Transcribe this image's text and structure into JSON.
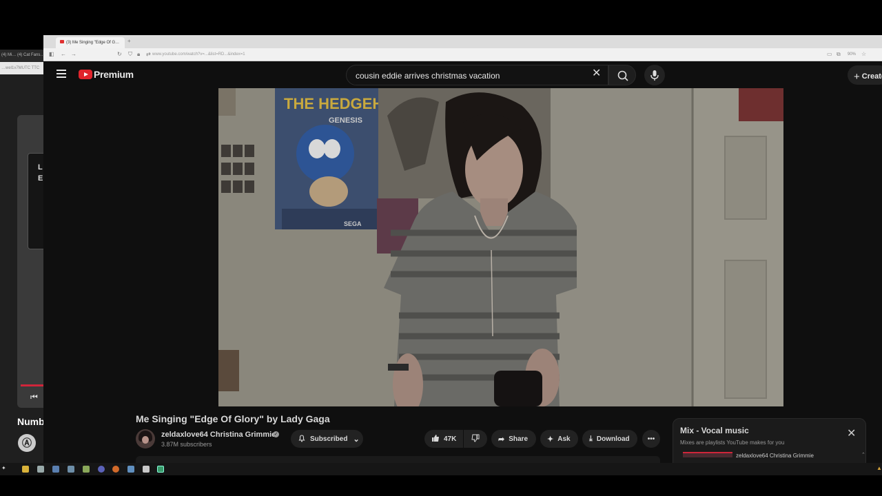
{
  "background_window": {
    "tab_text": "(4) Mi… (4) Cat Fans…",
    "url_text": "…wel1v7MUTC TTC",
    "card_text": "L\nE",
    "now_playing_title": "Numb"
  },
  "browser": {
    "tab_title": "(3) Me Singing \"Edge Of G…",
    "url": "www.youtube.com/watch?v=...&list=RD...&index=1",
    "zoom": "90%"
  },
  "youtube": {
    "logo_text": "Premium",
    "search": {
      "value": "cousin eddie arrives christmas vacation",
      "placeholder": "Search"
    },
    "create_label": "Create",
    "video": {
      "poster_title": "THE HEDGEHOG",
      "poster_subtitle": "GENESIS",
      "poster_brand": "SEGA"
    },
    "title": "Me Singing \"Edge Of Glory\" by Lady Gaga",
    "channel": {
      "name": "zeldaxlove64 Christina Grimmie",
      "subscribers": "3.87M subscribers"
    },
    "actions": {
      "subscribe": "Subscribed",
      "likes": "47K",
      "share": "Share",
      "ask": "Ask",
      "download": "Download"
    },
    "mix": {
      "title": "Mix - Vocal music",
      "subtitle": "Mixes are playlists YouTube makes for you",
      "first_item": "zeldaxlove64 Christina Grimmie"
    }
  },
  "colors": {
    "accent_red": "#e1242c",
    "page_bg": "#0f0f0f"
  }
}
